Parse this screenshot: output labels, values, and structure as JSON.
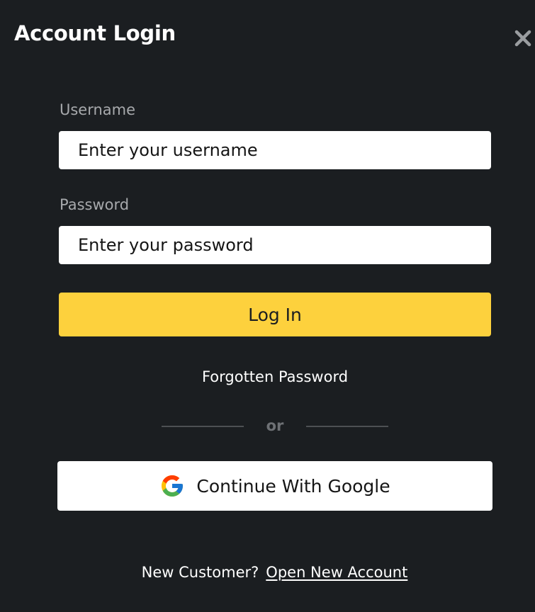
{
  "dialog": {
    "title": "Account Login",
    "close_icon": "close-icon"
  },
  "form": {
    "username_label": "Username",
    "username_placeholder": "Enter your username",
    "username_value": "",
    "password_label": "Password",
    "password_placeholder": "Enter your password",
    "password_value": "",
    "login_label": "Log In",
    "forgot_label": "Forgotten Password"
  },
  "divider": {
    "text": "or"
  },
  "google": {
    "label": "Continue With Google",
    "icon": "google-icon"
  },
  "footer": {
    "prompt": "New Customer?",
    "link_label": "Open New Account"
  },
  "colors": {
    "background": "#1b1e21",
    "accent": "#fdd13d",
    "label": "#a7a9ac",
    "divider": "#4d5053"
  }
}
